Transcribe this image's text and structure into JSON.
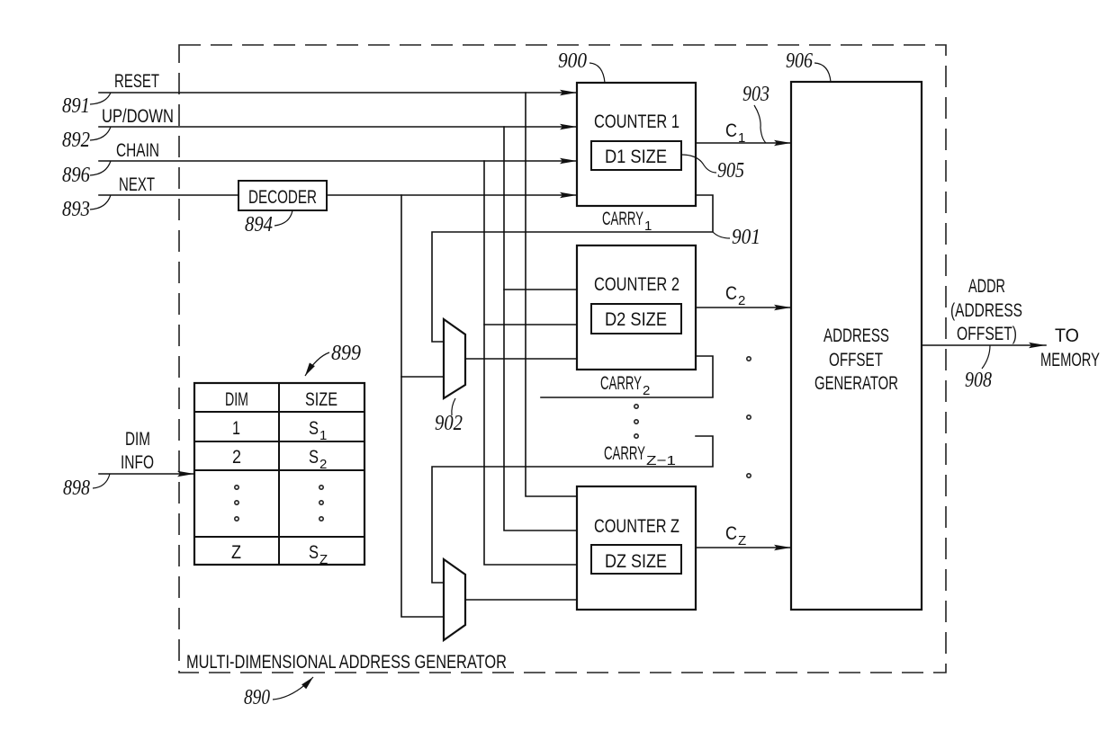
{
  "figure": {
    "title_label": "MULTI-DIMENSIONAL ADDRESS GENERATOR",
    "ref": "890"
  },
  "inputs": [
    {
      "label": "RESET",
      "ref": "891"
    },
    {
      "label": "UP/DOWN",
      "ref": "892"
    },
    {
      "label": "CHAIN",
      "ref": "896"
    },
    {
      "label": "NEXT",
      "ref": "893"
    }
  ],
  "decoder": {
    "label": "DECODER",
    "ref": "894"
  },
  "counters": [
    {
      "label": "COUNTER 1",
      "size_label": "D1 SIZE",
      "output": "C",
      "output_sub": "1",
      "carry": "CARRY",
      "carry_sub": "1",
      "ref": "900",
      "size_ref": "905",
      "output_ref": "903",
      "carry_ref": "901"
    },
    {
      "label": "COUNTER 2",
      "size_label": "D2 SIZE",
      "output": "C",
      "output_sub": "2",
      "carry": "CARRY",
      "carry_sub": "2"
    },
    {
      "label": "COUNTER Z",
      "size_label": "DZ SIZE",
      "output": "C",
      "output_sub": "Z"
    }
  ],
  "carry_z_minus_1": {
    "label": "CARRY",
    "sub": "Z−1"
  },
  "mux": {
    "ref": "902"
  },
  "address_generator": {
    "lines": [
      "ADDRESS",
      "OFFSET",
      "GENERATOR"
    ],
    "ref": "906"
  },
  "output": {
    "lines": [
      "ADDR",
      "(ADDRESS",
      "OFFSET)"
    ],
    "destination": [
      "TO",
      "MEMORY"
    ],
    "ref": "908"
  },
  "dim_info": {
    "lines": [
      "DIM",
      "INFO"
    ],
    "ref": "898"
  },
  "dim_table": {
    "ref": "899",
    "headers": [
      "DIM",
      "SIZE"
    ],
    "rows": [
      {
        "dim": "1",
        "size": "S",
        "size_sub": "1"
      },
      {
        "dim": "2",
        "size": "S",
        "size_sub": "2"
      },
      {
        "dim": "Z",
        "size": "S",
        "size_sub": "Z"
      }
    ]
  }
}
